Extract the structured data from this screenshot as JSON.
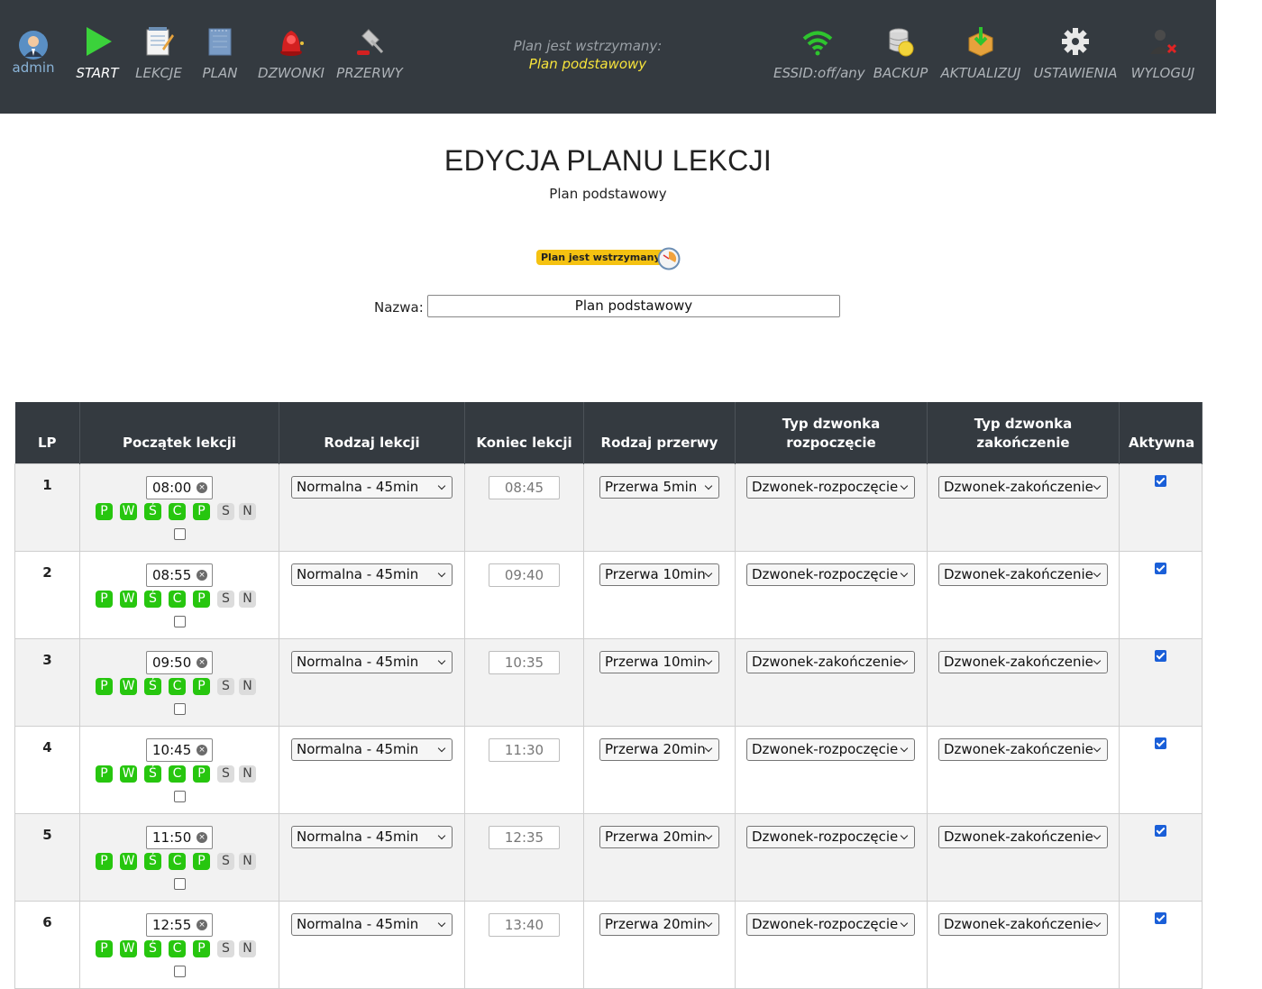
{
  "nav": {
    "user": "admin",
    "start": "START",
    "lessons": "LEKCJE",
    "plan": "PLAN",
    "bells": "DZWONKI",
    "breaks": "PRZERWY",
    "status_line1": "Plan jest wstrzymany:",
    "status_line2": "Plan podstawowy",
    "essid": "ESSID:off/any",
    "backup": "BACKUP",
    "update": "AKTUALIZUJ",
    "settings": "USTAWIENIA",
    "logout": "WYLOGUJ"
  },
  "page": {
    "title": "EDYCJA PLANU LEKCJI",
    "subtitle": "Plan podstawowy",
    "badge": "Plan jest wstrzymany",
    "name_label": "Nazwa:",
    "name_value": "Plan podstawowy"
  },
  "table": {
    "headers": [
      "LP",
      "Początek lekcji",
      "Rodzaj lekcji",
      "Koniec lekcji",
      "Rodzaj przerwy",
      "Typ dzwonka rozpoczęcie",
      "Typ dzwonka zakończenie",
      "Aktywna"
    ],
    "days": [
      "P",
      "W",
      "Ś",
      "C",
      "P",
      "S",
      "N"
    ],
    "rows": [
      {
        "lp": "1",
        "start_h": "08",
        "start_m": "00",
        "type": "Normalna - 45min",
        "end": "08:45",
        "break": "Przerwa 5min",
        "bell_start": "Dzwonek-rozpoczęcie",
        "bell_end": "Dzwonek-zakończenie",
        "active": true
      },
      {
        "lp": "2",
        "start_h": "08",
        "start_m": "55",
        "type": "Normalna - 45min",
        "end": "09:40",
        "break": "Przerwa 10min",
        "bell_start": "Dzwonek-rozpoczęcie",
        "bell_end": "Dzwonek-zakończenie",
        "active": true
      },
      {
        "lp": "3",
        "start_h": "09",
        "start_m": "50",
        "type": "Normalna - 45min",
        "end": "10:35",
        "break": "Przerwa 10min",
        "bell_start": "Dzwonek-zakończenie",
        "bell_end": "Dzwonek-zakończenie",
        "active": true
      },
      {
        "lp": "4",
        "start_h": "10",
        "start_m": "45",
        "type": "Normalna - 45min",
        "end": "11:30",
        "break": "Przerwa 20min",
        "bell_start": "Dzwonek-rozpoczęcie",
        "bell_end": "Dzwonek-zakończenie",
        "active": true
      },
      {
        "lp": "5",
        "start_h": "11",
        "start_m": "50",
        "type": "Normalna - 45min",
        "end": "12:35",
        "break": "Przerwa 20min",
        "bell_start": "Dzwonek-rozpoczęcie",
        "bell_end": "Dzwonek-zakończenie",
        "active": true
      },
      {
        "lp": "6",
        "start_h": "12",
        "start_m": "55",
        "type": "Normalna - 45min",
        "end": "13:40",
        "break": "Przerwa 20min",
        "bell_start": "Dzwonek-rozpoczęcie",
        "bell_end": "Dzwonek-zakończenie",
        "active": true
      }
    ]
  },
  "colors": {
    "topbar": "#343a40",
    "day_on": "#27c60f",
    "badge": "#f5c211",
    "status_highlight": "#f7e33b"
  },
  "icons": [
    "user-avatar-icon",
    "play-icon",
    "notepad-icon",
    "notebook-icon",
    "bell-icon",
    "gavel-icon",
    "wifi-icon",
    "database-icon",
    "package-icon",
    "gear-icon",
    "logout-user-icon",
    "clock-icon",
    "clear-icon",
    "chevron-down-icon"
  ]
}
